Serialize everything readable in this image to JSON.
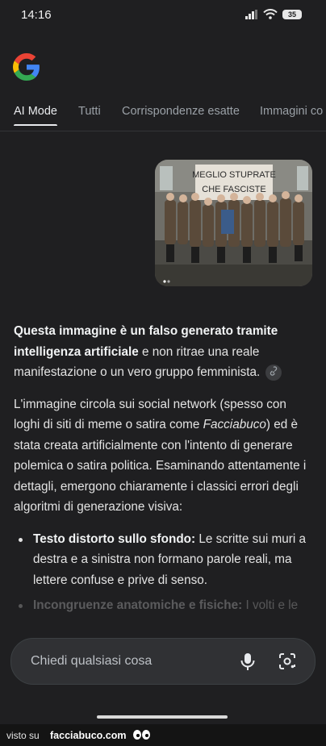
{
  "status_bar": {
    "time": "14:16",
    "battery": "35"
  },
  "tabs": [
    {
      "label": "AI Mode",
      "active": true
    },
    {
      "label": "Tutti"
    },
    {
      "label": "Corrispondenze esatte"
    },
    {
      "label": "Immagini co"
    }
  ],
  "image_banner_text": "MEGLIO STUPRATE CHE FASCISTE",
  "answer": {
    "p1_bold": "Questa immagine è un falso generato tramite intelligenza artificiale",
    "p1_rest": " e non ritrae una reale manifestazione o un vero gruppo femminista.",
    "p2_start": "L'immagine circola sui social network (spesso con loghi di siti di meme o satira come ",
    "p2_italic": "Facciabuco",
    "p2_end": ") ed è stata creata artificialmente con l'intento di generare polemica o satira politica. Esaminando attentamente i dettagli, emergono chiaramente i classici errori degli algoritmi di generazione visiva:",
    "bullets": [
      {
        "title": "Testo distorto sullo sfondo:",
        "text": " Le scritte sui muri a destra e a sinistra non formano parole reali, ma lettere confuse e prive di senso."
      },
      {
        "title": "Incongruenze anatomiche e fisiche:",
        "text": " I volti e le"
      }
    ]
  },
  "ask_bar": {
    "placeholder": "Chiedi qualsiasi cosa"
  },
  "watermark": {
    "prefix": "visto su",
    "site": "facciabuco.com"
  },
  "colors": {
    "background": "#1f1f21",
    "text": "#e3e3e3",
    "muted": "#9aa0a6",
    "input": "#303134"
  }
}
